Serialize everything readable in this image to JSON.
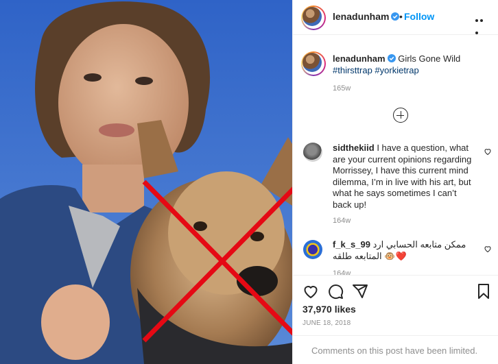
{
  "header": {
    "username": "lenadunham",
    "separator": "•",
    "follow_label": "Follow"
  },
  "caption": {
    "username": "lenadunham",
    "text": "Girls Gone Wild",
    "hashtags": "#thirsttrap #yorkietrap",
    "time": "165w"
  },
  "comments": [
    {
      "username": "sidthekiid",
      "text": "I have a question, what are your current opinions regarding Morrissey, I have this current mind dilemma, I’m in live with his art, but what he says sometimes I can’t back up!",
      "time": "164w"
    },
    {
      "username": "f_k_s_99",
      "text": "ممكن متابعه الحسابي ارد المتابعه طلقه 🐵❤️",
      "time": "164w"
    }
  ],
  "footer": {
    "likes": "37,970 likes",
    "date": "JUNE 18, 2018",
    "comments_limited": "Comments on this post have been limited."
  },
  "icons": {
    "verified": "verified-badge-icon",
    "more": "more-options-icon",
    "load_more": "plus-circle-icon",
    "like": "heart-icon",
    "comment": "comment-icon",
    "share": "paper-plane-icon",
    "save": "bookmark-icon"
  },
  "colors": {
    "accent": "#0095f6",
    "verified": "#3897f0",
    "overlay_x": "#e50914",
    "muted": "#8e8e8e"
  }
}
